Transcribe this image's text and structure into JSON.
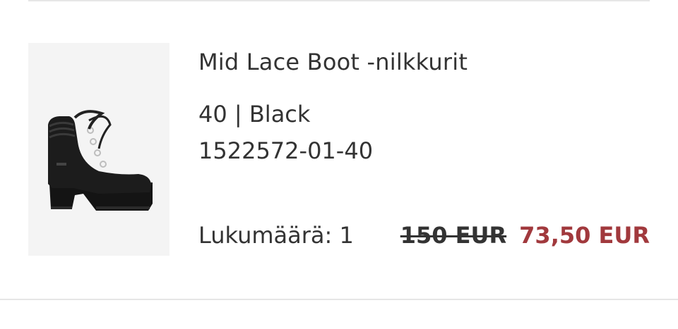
{
  "product": {
    "name": "Mid Lace Boot -nilkkurit",
    "variant": "40 | Black",
    "sku": "1522572-01-40",
    "image_alt": "Mid Lace Boot black ankle boot",
    "quantity_label": "Lukumäärä: 1",
    "original_price": "150 EUR",
    "sale_price": "73,50 EUR"
  },
  "colors": {
    "sale_price": "#a1393d",
    "text": "#333333",
    "image_bg": "#f4f4f4",
    "divider": "#e6e6e6"
  }
}
